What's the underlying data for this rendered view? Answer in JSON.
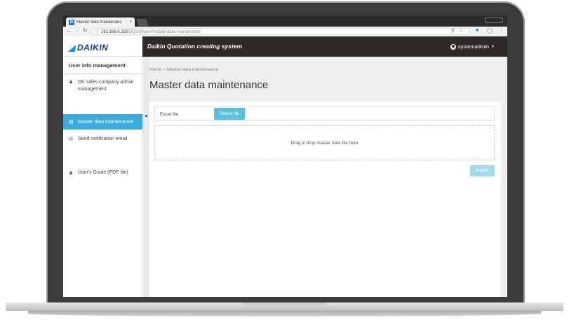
{
  "browser": {
    "tab_title": "Master data maintenanc",
    "tab_icon_letter": "D",
    "tab_close": "×",
    "url_host": "192.168.6.192",
    "url_path": "/DQS/Web/#/master-data-maintenance"
  },
  "header": {
    "logo_text": "DAIKIN",
    "app_title": "Daikin Quotation creating system",
    "user_name": "systemadmin"
  },
  "sidebar": {
    "heading": "User info management",
    "items": [
      {
        "label": "DK sales company admin management",
        "icon": "user-icon"
      },
      {
        "label": "Master data maintenance",
        "icon": "database-icon",
        "active": true
      },
      {
        "label": "Send notification email",
        "icon": "envelope-icon"
      },
      {
        "label": "User's Guide (PDF file)",
        "icon": "user-icon"
      }
    ]
  },
  "main": {
    "breadcrumb_home": "Home",
    "breadcrumb_sep": ">",
    "breadcrumb_current": "Master data maintenance",
    "page_title": "Master data maintenance",
    "excel_label": "Excel file",
    "select_button": "Select file",
    "dropzone_text": "Drag & drop master data file here",
    "import_button": "Import"
  },
  "colors": {
    "header_bg": "#2f2a28",
    "active_item": "#3dabdc",
    "primary_button": "#5bc0de",
    "disabled_button": "#a4dcee",
    "logo_blue": "#0d3c8c"
  }
}
